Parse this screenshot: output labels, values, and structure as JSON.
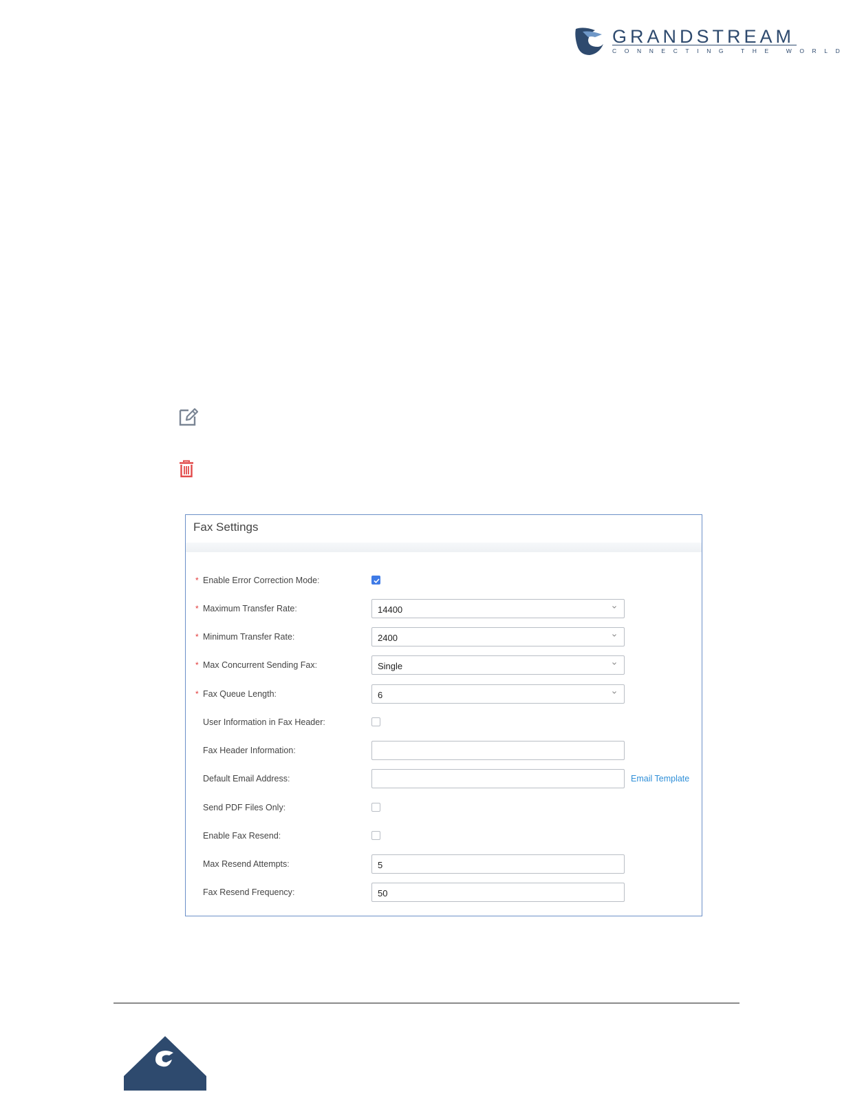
{
  "brand": {
    "name": "GRANDSTREAM",
    "tagline": "CONNECTING THE WORLD",
    "colors": {
      "primary": "#2e4a6e",
      "accent": "#3f7be6",
      "link": "#2f8fd8",
      "required": "#e23b3b"
    }
  },
  "icons": {
    "edit": "edit-icon",
    "delete": "trash-icon"
  },
  "fax_settings": {
    "title": "Fax Settings",
    "rows": [
      {
        "label": "Enable Error Correction Mode",
        "required": true,
        "type": "checkbox",
        "checked": true
      },
      {
        "label": "Maximum Transfer Rate",
        "required": true,
        "type": "select",
        "value": "14400"
      },
      {
        "label": "Minimum Transfer Rate",
        "required": true,
        "type": "select",
        "value": "2400"
      },
      {
        "label": "Max Concurrent Sending Fax",
        "required": true,
        "type": "select",
        "value": "Single"
      },
      {
        "label": "Fax Queue Length",
        "required": true,
        "type": "select",
        "value": "6"
      },
      {
        "label": "User Information in Fax Header",
        "required": false,
        "type": "checkbox",
        "checked": false
      },
      {
        "label": "Fax Header Information",
        "required": false,
        "type": "input",
        "value": ""
      },
      {
        "label": "Default Email Address",
        "required": false,
        "type": "input",
        "value": "",
        "link": "Email Template"
      },
      {
        "label": "Send PDF Files Only",
        "required": false,
        "type": "checkbox",
        "checked": false
      },
      {
        "label": "Enable Fax Resend",
        "required": false,
        "type": "checkbox",
        "checked": false
      },
      {
        "label": "Max Resend Attempts",
        "required": false,
        "type": "input",
        "value": "5"
      },
      {
        "label": "Fax Resend Frequency",
        "required": false,
        "type": "input",
        "value": "50"
      }
    ]
  }
}
